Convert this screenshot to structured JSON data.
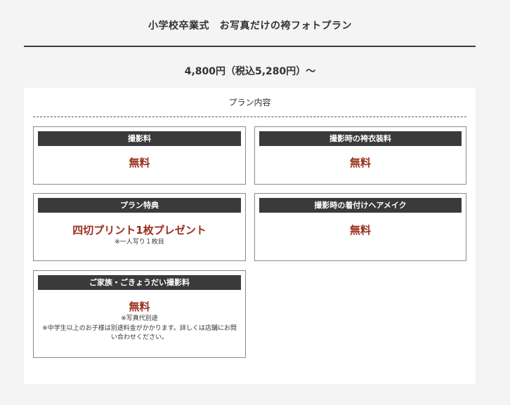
{
  "plan": {
    "title": "小学校卒業式　お写真だけの袴フォトプラン",
    "price": "4,800円（税込5,280円）〜"
  },
  "contents": {
    "heading": "プラン内容",
    "cards": [
      {
        "label": "撮影料",
        "value": "無料"
      },
      {
        "label": "撮影時の袴衣装料",
        "value": "無料"
      },
      {
        "label": "プラン特典",
        "value": "四切プリント1枚プレゼント",
        "note": "※一人写り１枚目"
      },
      {
        "label": "撮影時の着付けヘアメイク",
        "value": "無料"
      },
      {
        "label": "ご家族・ごきょうだい撮影料",
        "value": "無料",
        "note": "※写真代別途",
        "note2": "※中学生以上のお子様は別途料金がかかります。詳しくは店舗にお問い合わせください。"
      }
    ]
  },
  "colors": {
    "accent": "#9a2e1a",
    "header_bg": "#3a3a3a",
    "page_bg": "#f4f4f4"
  }
}
